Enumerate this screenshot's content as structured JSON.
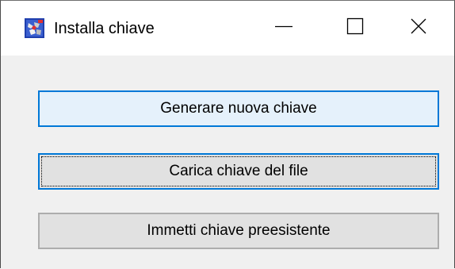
{
  "window": {
    "title": "Installa chiave",
    "icon": "app-icon",
    "controls": {
      "minimize_icon": "minimize-icon",
      "maximize_icon": "maximize-icon",
      "close_icon": "close-icon"
    }
  },
  "buttons": {
    "generate_label": "Generare nuova chiave",
    "load_label": "Carica chiave del file",
    "enter_label": "Immetti chiave preesistente"
  },
  "colors": {
    "focus_border": "#0078d7",
    "hover_fill": "#e5f1fb",
    "button_fill": "#e1e1e1",
    "button_border": "#adadad",
    "dialog_background": "#f0f0f0"
  }
}
